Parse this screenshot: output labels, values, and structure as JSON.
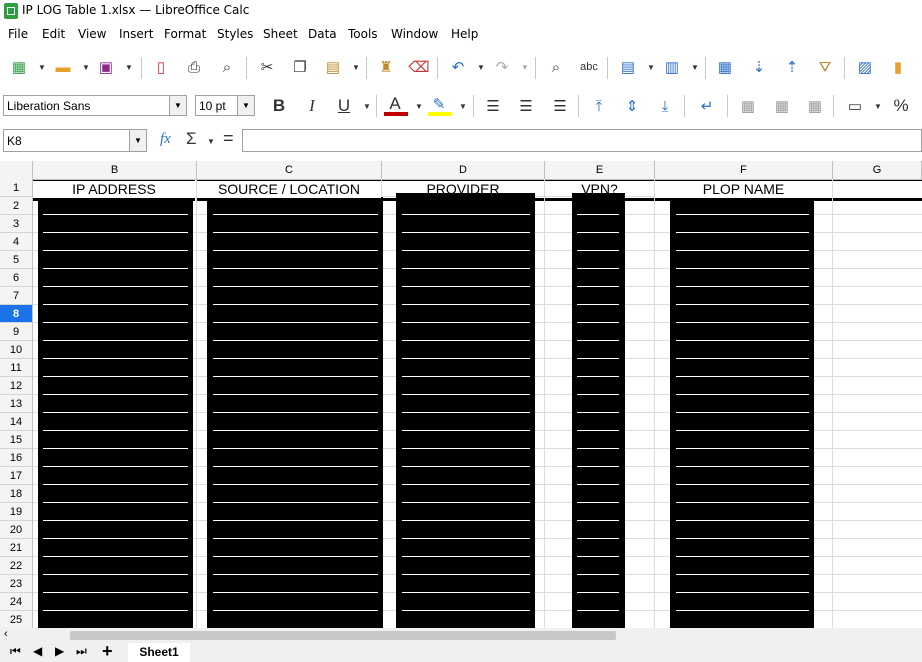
{
  "window": {
    "title": "IP LOG Table 1.xlsx — LibreOffice Calc"
  },
  "menu": [
    "File",
    "Edit",
    "View",
    "Insert",
    "Format",
    "Styles",
    "Sheet",
    "Data",
    "Tools",
    "Window",
    "Help"
  ],
  "format_toolbar": {
    "font_name": "Liberation Sans",
    "font_size": "10 pt",
    "bold": "B",
    "italic": "I",
    "underline": "U",
    "font_color": "A",
    "percent": "%"
  },
  "formula_bar": {
    "cell_ref": "K8",
    "fx": "fx",
    "sigma": "Σ",
    "equals": "=",
    "content": ""
  },
  "columns": [
    "B",
    "C",
    "D",
    "E",
    "F",
    "G"
  ],
  "rows": [
    "1",
    "2",
    "3",
    "4",
    "5",
    "6",
    "7",
    "8",
    "9",
    "10",
    "11",
    "12",
    "13",
    "14",
    "15",
    "16",
    "17",
    "18",
    "19",
    "20",
    "21",
    "22",
    "23",
    "24",
    "25"
  ],
  "active_row": "8",
  "headers": {
    "ip_address": "IP ADDRESS",
    "source_location": "SOURCE / LOCATION",
    "provider": "PROVIDER",
    "vpn": "VPN?",
    "plop_name": "PLOP NAME"
  },
  "sheet_tabs": [
    "Sheet1"
  ],
  "colors": {
    "accent": "#1a73e8",
    "redaction": "#000000",
    "font_color_bar": "#c00000",
    "highlight_bar": "#ffff00"
  }
}
